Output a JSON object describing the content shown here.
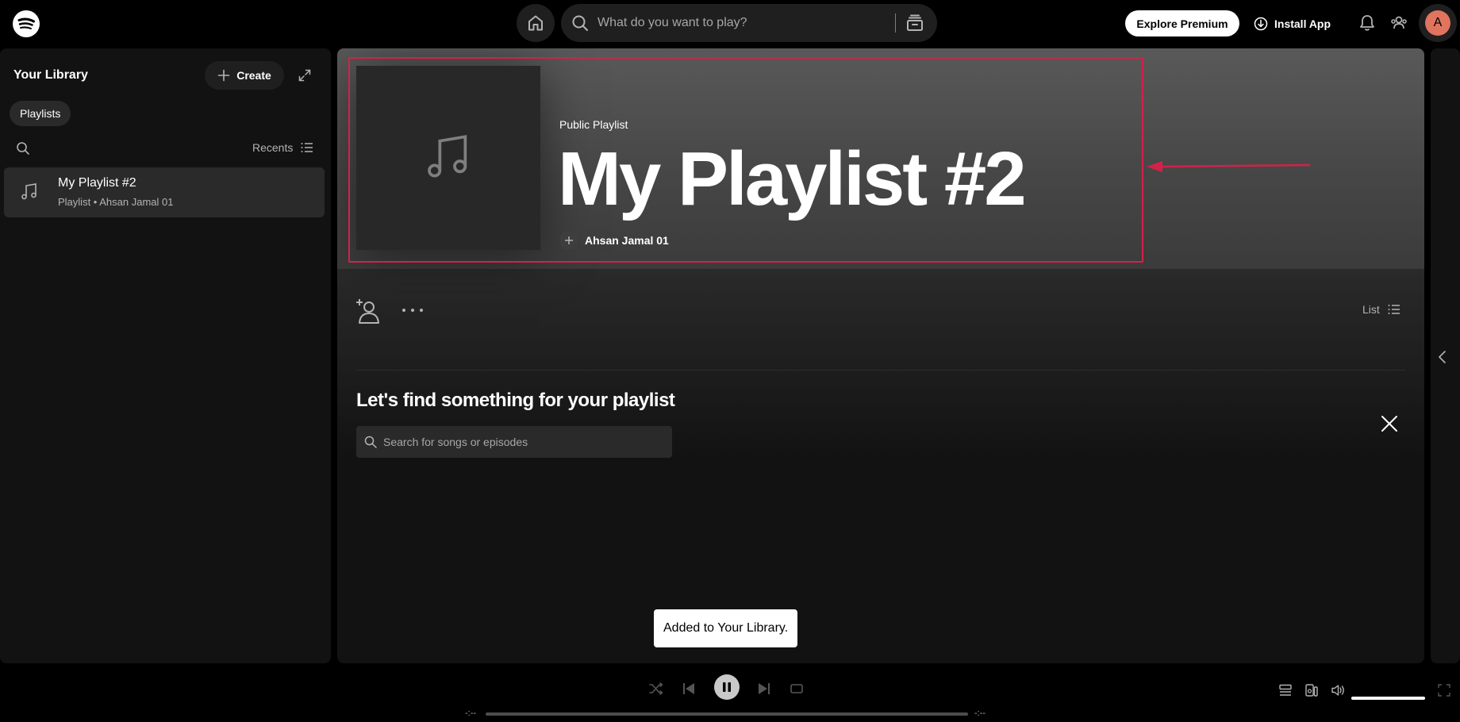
{
  "topbar": {
    "search_placeholder": "What do you want to play?",
    "explore_label": "Explore Premium",
    "install_label": "Install App",
    "avatar_initial": "A"
  },
  "sidebar": {
    "title": "Your Library",
    "create_label": "Create",
    "filter_chip": "Playlists",
    "sort_label": "Recents",
    "items": [
      {
        "title": "My Playlist #2",
        "subtitle": "Playlist • Ahsan Jamal 01"
      }
    ]
  },
  "playlist": {
    "type_label": "Public Playlist",
    "title": "My Playlist #2",
    "owner": "Ahsan Jamal 01",
    "view_label": "List"
  },
  "find": {
    "title": "Let's find something for your playlist",
    "search_placeholder": "Search for songs or episodes"
  },
  "toast": {
    "message": "Added to Your Library."
  },
  "player": {
    "time_elapsed": "-:--",
    "time_total": "-:--",
    "progress": 0,
    "volume": 1.0,
    "state": "playing"
  },
  "colors": {
    "highlight": "#d3214a",
    "background": "#121212",
    "avatar": "#e0745e"
  }
}
